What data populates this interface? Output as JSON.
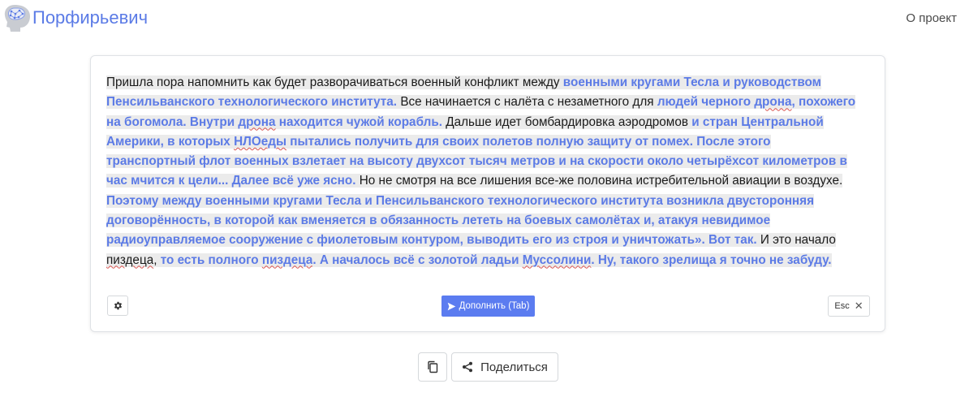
{
  "navbar": {
    "title": "Порфирьевич",
    "about_label": "О проект",
    "logo_icon": "brain-head-icon"
  },
  "editor": {
    "segments": [
      {
        "text": "Пришла пора напомнить как будет разворачиваться военный конфликт между ",
        "ai": false
      },
      {
        "text": "военными кругами Тесла и руководством Пенсильванского технологического института. ",
        "ai": true
      },
      {
        "text": " Все начинается с налёта с незаметного для ",
        "ai": false
      },
      {
        "text": "людей черного ",
        "ai": true
      },
      {
        "text": "дрона",
        "ai": true,
        "err": true
      },
      {
        "text": ", похожего на богомола. Внутри ",
        "ai": true
      },
      {
        "text": "дрона",
        "ai": true,
        "err": true
      },
      {
        "text": " находится чужой корабль.",
        "ai": true
      },
      {
        "text": " Дальше идет бомбардировка аэродромов ",
        "ai": false
      },
      {
        "text": "и стран Центральной Америки, в которых  ",
        "ai": true
      },
      {
        "text": "НЛОеды",
        "ai": true,
        "err": true
      },
      {
        "text": " пытались получить для своих полетов полную защиту от помех.  После этого транспортный флот военных взлетает на высоту двухсот тысяч метров и на скорости около четырёхсот километров в час мчится к цели... Далее всё уже ясно.",
        "ai": true
      },
      {
        "text": " Но не смотря на все лишения все-же половина истребительной авиации в воздухе. ",
        "ai": false
      },
      {
        "text": "Поэтому между военными кругами Тесла и Пенсильванского технологического института возникла двусторонняя договорённость, в которой как вменяется в обязанность  лететь на боевых самолётах и, атакуя невидимое радиоуправляемое сооружение с фиолетовым контуром, выводить его из строя и уничтожать». Вот так.",
        "ai": true
      },
      {
        "text": " И это начало ",
        "ai": false
      },
      {
        "text": "пиздеца",
        "ai": false,
        "err": true
      },
      {
        "text": ", ",
        "ai": false
      },
      {
        "text": " то есть полного ",
        "ai": true
      },
      {
        "text": "пиздеца",
        "ai": true,
        "err": true
      },
      {
        "text": ". А началось всё с золотой ладьи ",
        "ai": true
      },
      {
        "text": "Муссолини",
        "ai": true,
        "err": true
      },
      {
        "text": ". Ну, такого зрелища я точно не забуду.",
        "ai": true
      }
    ]
  },
  "toolbar": {
    "settings_icon": "gear-icon",
    "complete_label": "Дополнить (Tab)",
    "complete_icon": "send-icon",
    "esc_label": "Esc",
    "esc_icon": "close-icon"
  },
  "actions": {
    "copy_icon": "copy-icon",
    "share_label": "Поделиться",
    "share_icon": "share-icon"
  },
  "colors": {
    "brand": "#5b7be6",
    "ai_text": "#5c7be6",
    "highlight": "#ebebeb",
    "primary_button": "#5b7cf0"
  }
}
